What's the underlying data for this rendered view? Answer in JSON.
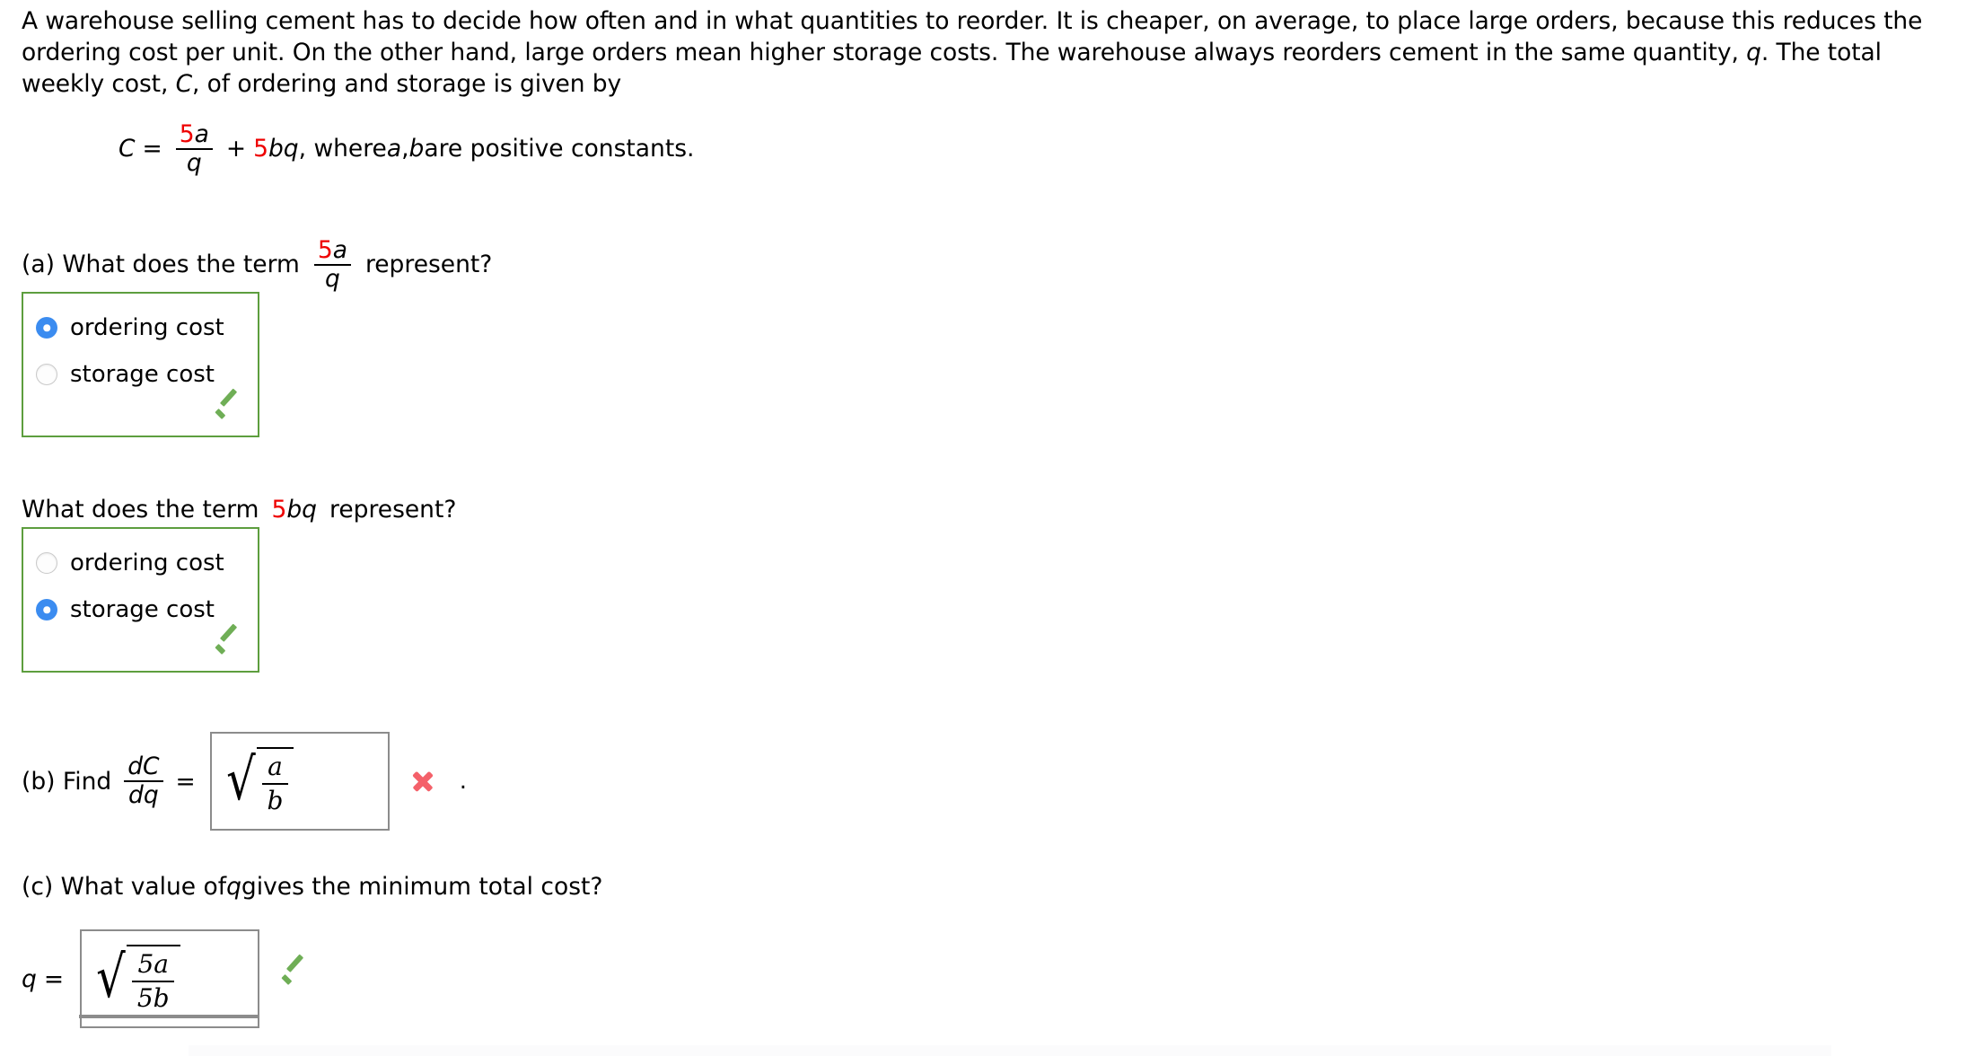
{
  "intro": {
    "text_1": "A warehouse selling cement has to decide how often and in what quantities to reorder. It is cheaper, on average, to place large orders, because this reduces the ordering cost per unit. On the other hand, large orders mean higher storage costs. The warehouse always reorders cement in the same quantity, ",
    "var_q": "q",
    "text_2": ". The total weekly cost, ",
    "var_C": "C",
    "text_3": ", of ordering and storage is given by"
  },
  "equation": {
    "lhs": "C",
    "equals": "=",
    "frac_num_coef": "5",
    "frac_num_var": "a",
    "frac_den": "q",
    "plus": "+",
    "term2_coef": "5",
    "term2_vars": "bq",
    "tail": ", where ",
    "const_a": "a",
    "comma": ", ",
    "const_b": "b",
    "tail2": " are positive constants."
  },
  "part_a": {
    "label": "(a) What does the term",
    "frac_num_coef": "5",
    "frac_num_var": "a",
    "frac_den": "q",
    "suffix": "represent?",
    "choices": [
      {
        "label": "ordering cost",
        "selected": true
      },
      {
        "label": "storage cost",
        "selected": false
      }
    ],
    "result_icon": "green-check-icon"
  },
  "part_a2": {
    "label": "What does the term",
    "term_coef": "5",
    "term_vars": "bq",
    "suffix": "represent?",
    "choices": [
      {
        "label": "ordering cost",
        "selected": false
      },
      {
        "label": "storage cost",
        "selected": true
      }
    ],
    "result_icon": "green-check-icon"
  },
  "part_b": {
    "label": "(b) Find",
    "deriv_num": "dC",
    "deriv_den": "dq",
    "equals": "=",
    "answer": {
      "radical": "√",
      "num": "a",
      "den": "b"
    },
    "result_icon": "red-x-icon",
    "period": "."
  },
  "part_c": {
    "label_1": "(c) What value of ",
    "var_q": "q",
    "label_2": " gives the minimum total cost?",
    "lead_var": "q",
    "lead_equals": "=",
    "answer": {
      "radical": "√",
      "num": "5a",
      "den": "5b"
    },
    "result_icon": "green-check-icon"
  },
  "colors": {
    "accent_red": "#ee0000",
    "correct_green": "#6fae56",
    "correct_border_green": "#5d9e3e",
    "incorrect_red": "#f4616a",
    "radio_blue": "#3b8cf0",
    "box_border_gray": "#8c8c8c"
  }
}
